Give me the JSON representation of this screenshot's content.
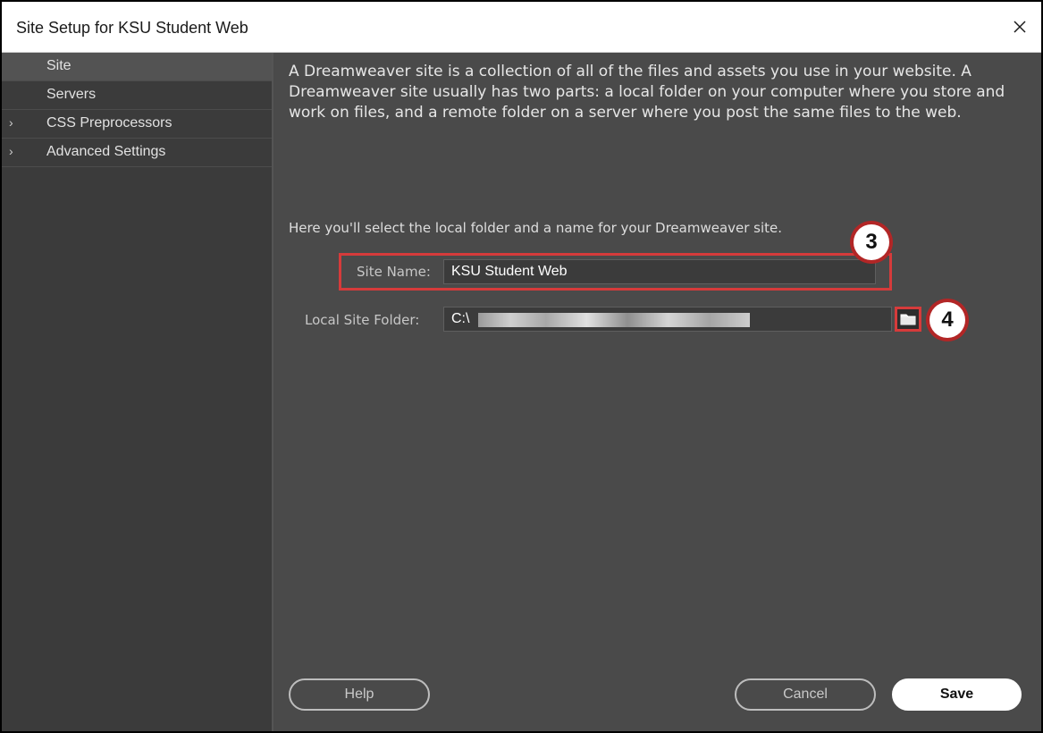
{
  "window": {
    "title": "Site Setup for KSU Student Web"
  },
  "sidebar": {
    "items": [
      {
        "label": "Site",
        "selected": true,
        "expandable": false
      },
      {
        "label": "Servers",
        "selected": false,
        "expandable": false
      },
      {
        "label": "CSS Preprocessors",
        "selected": false,
        "expandable": true
      },
      {
        "label": "Advanced Settings",
        "selected": false,
        "expandable": true
      }
    ]
  },
  "main": {
    "intro": "A Dreamweaver site is a collection of all of the files and assets you use in your website. A Dreamweaver site usually has two parts: a local folder on your computer where you store and work on files, and a remote folder on a server where you post the same files to the web.",
    "instruction": "Here you'll select the local folder and a name for your Dreamweaver site.",
    "site_name": {
      "label": "Site Name:",
      "value": "KSU Student Web"
    },
    "local_folder": {
      "label": "Local Site Folder:",
      "value": "C:\\"
    }
  },
  "callouts": {
    "step3": "3",
    "step4": "4"
  },
  "buttons": {
    "help": "Help",
    "cancel": "Cancel",
    "save": "Save"
  },
  "icons": {
    "close": "close-icon",
    "folder": "folder-icon",
    "chevron": "chevron-right-icon"
  },
  "colors": {
    "highlight": "#d63b3b",
    "panel": "#4a4a4a",
    "sidebar": "#3b3b3b"
  }
}
